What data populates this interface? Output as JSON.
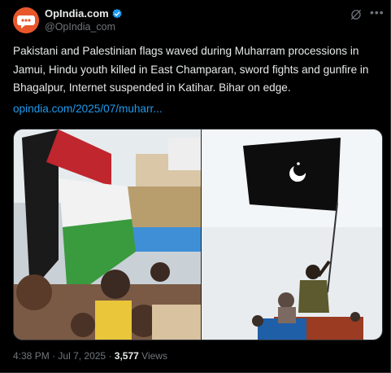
{
  "account": {
    "name": "OpIndia.com",
    "handle": "@OpIndia_com",
    "verified": true,
    "avatar_icon": "speech-bubble-logo-icon",
    "brand_color": "#e8572b",
    "verified_color": "#1d9bf0"
  },
  "tweet": {
    "text": "Pakistani and Palestinian flags waved during Muharram processions in Jamui, Hindu youth killed in East Champaran, sword fights and gunfire in Bhagalpur, Internet suspended in Katihar. Bihar on edge.",
    "link": "opindia.com/2025/07/muharr..."
  },
  "meta": {
    "time": "4:38 PM",
    "date": "Jul 7, 2025",
    "views_count": "3,577",
    "views_label": "Views"
  },
  "icons": {
    "grok": "grok-icon",
    "more": "more-options-icon"
  },
  "colors": {
    "background": "#000000",
    "text": "#e7e9ea",
    "secondary": "#71767b",
    "link": "#1d9bf0"
  }
}
